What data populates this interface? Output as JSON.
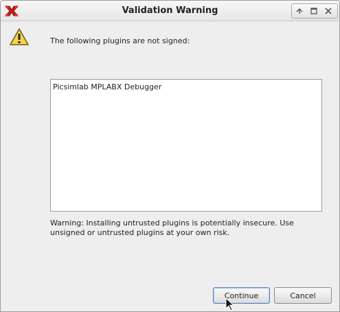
{
  "window": {
    "title": "Validation Warning",
    "app_icon": "x-logo-icon",
    "controls": [
      "minimize-icon",
      "maximize-icon",
      "close-icon"
    ]
  },
  "dialog": {
    "icon": "warning-icon",
    "message": "The following plugins are not signed:",
    "plugins": [
      "Picsimlab MPLABX Debugger"
    ],
    "warning": "Warning: Installing untrusted plugins is potentially insecure. Use unsigned or untrusted plugins at your own risk."
  },
  "buttons": {
    "continue_label": "Continue",
    "cancel_label": "Cancel"
  }
}
